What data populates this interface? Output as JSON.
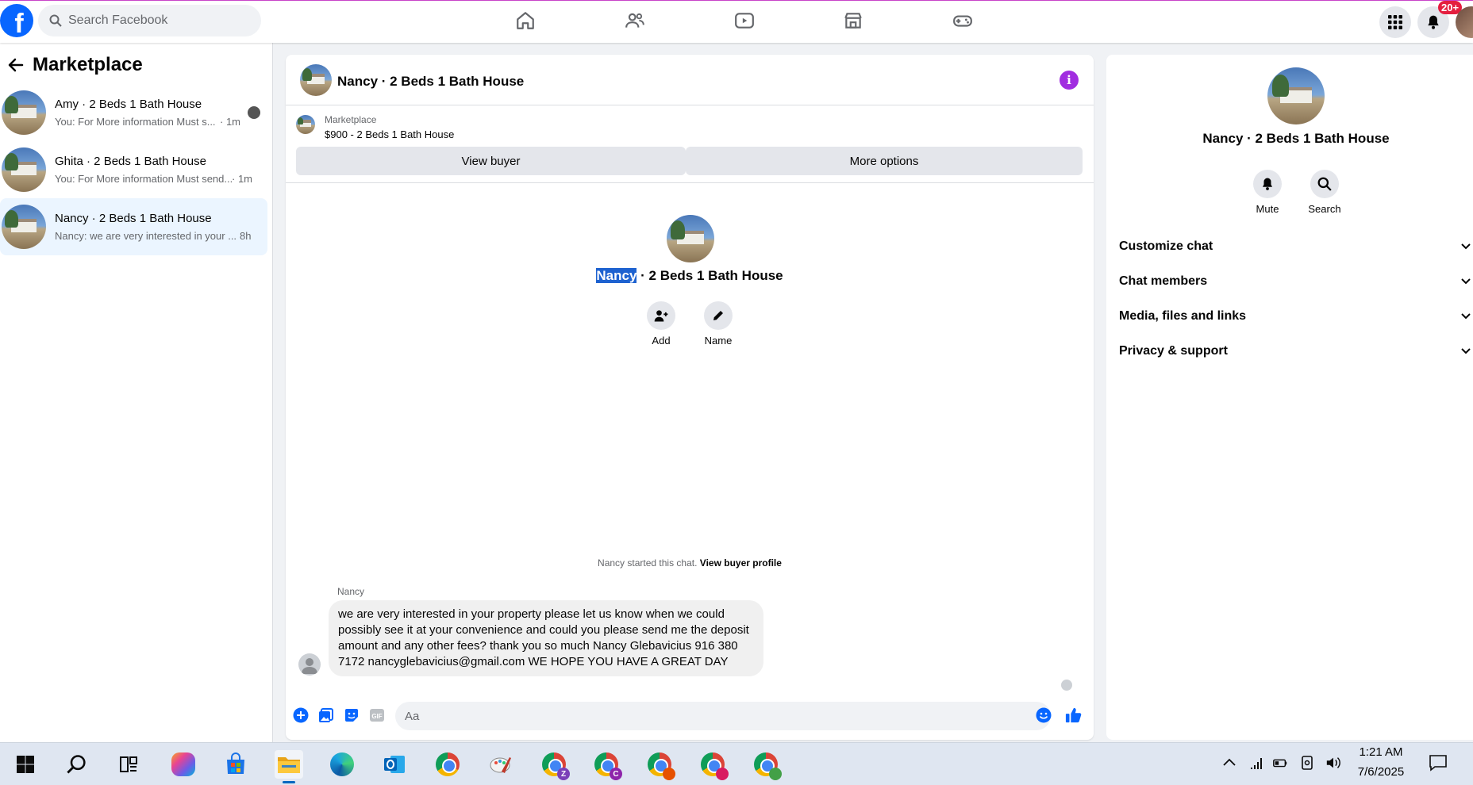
{
  "topbar": {
    "logo_letter": "f",
    "search_placeholder": "Search Facebook",
    "notification_badge": "20+",
    "nav_icons": [
      "home-icon",
      "friends-icon",
      "video-icon",
      "marketplace-icon",
      "gaming-icon"
    ]
  },
  "sidebar": {
    "title": "Marketplace",
    "conversations": [
      {
        "name": "Amy · 2 Beds 1 Bath House",
        "preview": "You: For More information Must s...",
        "time": "· 1m",
        "active": false
      },
      {
        "name": "Ghita · 2 Beds 1 Bath House",
        "preview": "You: For More information Must send...",
        "time": "· 1m",
        "active": false
      },
      {
        "name": "Nancy · 2 Beds 1 Bath House",
        "preview": "Nancy: we are very interested in your ...",
        "time": "8h",
        "active": true
      }
    ]
  },
  "chat": {
    "title": "Nancy · 2 Beds 1 Bath House",
    "marketplace_label": "Marketplace",
    "listing": "$900 - 2 Beds 1 Bath House",
    "view_buyer_label": "View buyer",
    "more_options_label": "More options",
    "profile_title_selected": "Nancy",
    "profile_title_rest": " · 2 Beds 1 Bath House",
    "add_label": "Add",
    "name_label": "Name",
    "started_text": "Nancy started this chat.",
    "view_buyer_profile_label": "View buyer profile",
    "sender": "Nancy",
    "message": "we are very interested in your property please let us know when we could possibly see it at your convenience and could you please send me the deposit amount and any other fees? thank you so much Nancy Glebavicius 916 380 7172 nancyglebavicius@gmail.com WE HOPE YOU HAVE A GREAT DAY",
    "composer_placeholder": "Aa",
    "gif_label": "GIF"
  },
  "right_panel": {
    "title": "Nancy · 2 Beds 1 Bath House",
    "mute_label": "Mute",
    "search_label": "Search",
    "sections": [
      "Customize chat",
      "Chat members",
      "Media, files and links",
      "Privacy & support"
    ]
  },
  "taskbar": {
    "time": "1:21 AM",
    "date": "7/6/2025",
    "chrome_profiles": [
      "Z",
      "C",
      "",
      "",
      ""
    ]
  },
  "colors": {
    "facebook_blue": "#0866ff",
    "info_purple": "#a12de0",
    "selected_conversation_bg": "#ebf5ff",
    "text_selection": "#1e62d0",
    "badge_red": "#e41e3f"
  }
}
